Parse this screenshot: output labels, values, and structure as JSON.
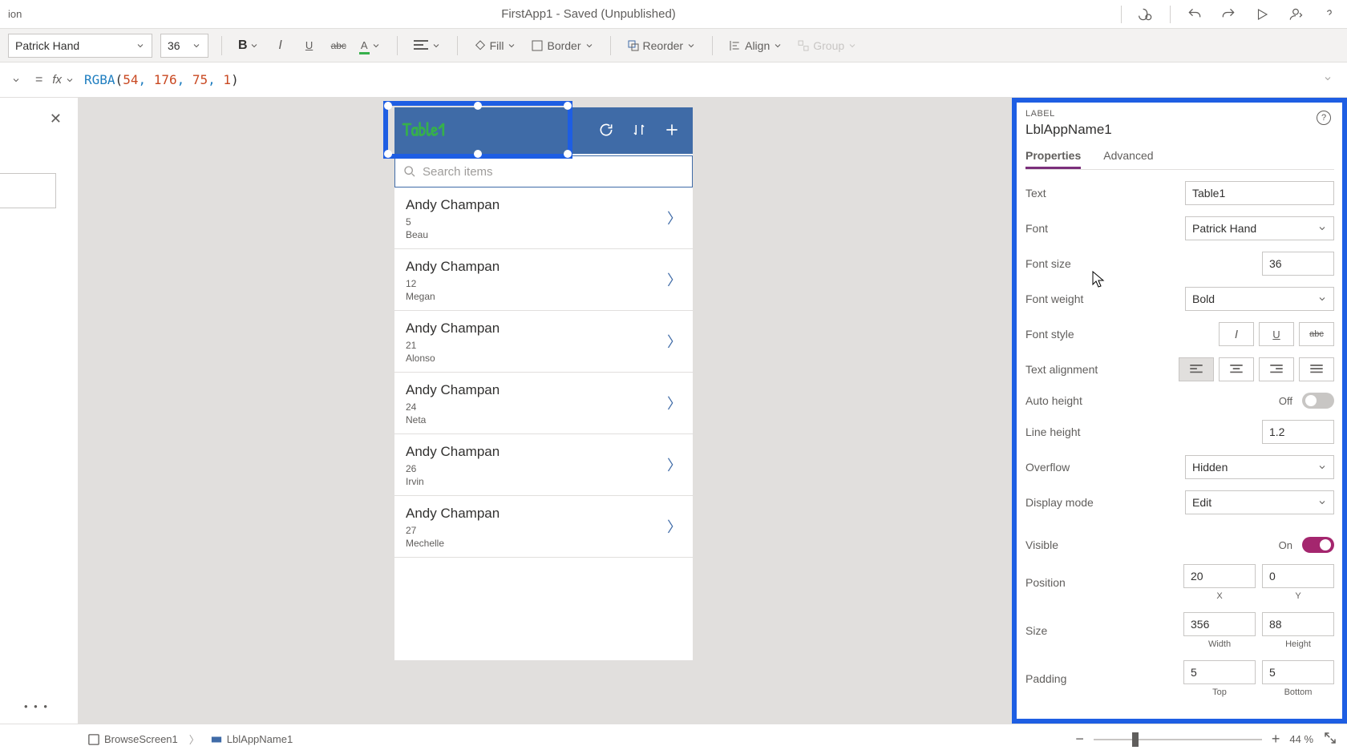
{
  "titlebar": {
    "left_fragment": "ion",
    "title": "FirstApp1 - Saved (Unpublished)"
  },
  "ribbon": {
    "font": "Patrick Hand",
    "font_size": "36",
    "fill_label": "Fill",
    "border_label": "Border",
    "reorder_label": "Reorder",
    "align_label": "Align",
    "group_label": "Group"
  },
  "formula": {
    "fx_label": "fx",
    "fn": "RGBA",
    "args": [
      "54",
      "176",
      "75",
      "1"
    ]
  },
  "app_preview": {
    "title": "Table1",
    "search_placeholder": "Search items",
    "rows": [
      {
        "title": "Andy Champan",
        "line1": "5",
        "line2": "Beau"
      },
      {
        "title": "Andy Champan",
        "line1": "12",
        "line2": "Megan"
      },
      {
        "title": "Andy Champan",
        "line1": "21",
        "line2": "Alonso"
      },
      {
        "title": "Andy Champan",
        "line1": "24",
        "line2": "Neta"
      },
      {
        "title": "Andy Champan",
        "line1": "26",
        "line2": "Irvin"
      },
      {
        "title": "Andy Champan",
        "line1": "27",
        "line2": "Mechelle"
      }
    ]
  },
  "breadcrumb": {
    "screen": "BrowseScreen1",
    "control": "LblAppName1"
  },
  "zoom": {
    "percent": "44",
    "suffix": "%"
  },
  "props": {
    "type_label": "LABEL",
    "control_name": "LblAppName1",
    "tab_properties": "Properties",
    "tab_advanced": "Advanced",
    "labels": {
      "text": "Text",
      "font": "Font",
      "font_size": "Font size",
      "font_weight": "Font weight",
      "font_style": "Font style",
      "text_align": "Text alignment",
      "auto_height": "Auto height",
      "line_height": "Line height",
      "overflow": "Overflow",
      "display_mode": "Display mode",
      "visible": "Visible",
      "position": "Position",
      "size": "Size",
      "padding": "Padding",
      "x": "X",
      "y": "Y",
      "width": "Width",
      "height": "Height",
      "top": "Top",
      "bottom": "Bottom",
      "off": "Off",
      "on": "On"
    },
    "values": {
      "text": "Table1",
      "font": "Patrick Hand",
      "font_size": "36",
      "font_weight": "Bold",
      "line_height": "1.2",
      "overflow": "Hidden",
      "display_mode": "Edit",
      "pos_x": "20",
      "pos_y": "0",
      "size_w": "356",
      "size_h": "88",
      "pad_top": "5",
      "pad_bottom": "5"
    }
  }
}
